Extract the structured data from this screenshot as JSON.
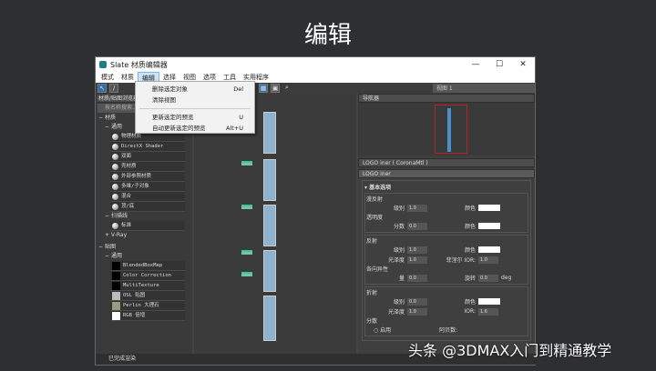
{
  "slide_title": "编辑",
  "window": {
    "title": "Slate 材质编辑器",
    "minimize": "—",
    "maximize": "☐",
    "close": "✕"
  },
  "menu": [
    "模式",
    "材质",
    "编辑",
    "选择",
    "视图",
    "选项",
    "工具",
    "实用程序"
  ],
  "edit_menu": [
    {
      "label": "删除选定对象",
      "shortcut": "Del"
    },
    {
      "label": "清除视图",
      "shortcut": ""
    },
    {
      "label": "更新选定的预览",
      "shortcut": "U"
    },
    {
      "label": "自动更新选定的预览",
      "shortcut": "Alt+U"
    }
  ],
  "view_select": "视图 1",
  "left": {
    "header": "材质/贴图浏览器",
    "search": "按名称搜索...",
    "materials": "材质",
    "general": "通用",
    "mat_items": [
      "物理材质",
      "DirectX Shader",
      "双面",
      "壳材质",
      "外部参照材质",
      "多维/子对象",
      "混合",
      "顶/底"
    ],
    "scanline": "扫描线",
    "scanline_items": [
      "标准"
    ],
    "vray": "+ V-Ray",
    "maps": "贴图",
    "maps_general": "通用",
    "map_items": [
      "BlendedBoxMap",
      "Color Correction",
      "MultiTexture",
      "OSL 贴图",
      "Perlin 大理石",
      "RGB 倍增"
    ]
  },
  "right": {
    "navigator": "导航器",
    "material_header": "LOGO iner ( CoronaMtl )",
    "material_name": "LOGO iner",
    "basic": "基本选项",
    "diffuse": {
      "title": "漫反射",
      "level_label": "级别",
      "level": "1.0",
      "color_label": "颜色"
    },
    "translucency": {
      "title": "透明度",
      "fraction_label": "分数",
      "fraction": "0.0",
      "color_label": "颜色"
    },
    "reflection": {
      "title": "反射",
      "level_label": "级别",
      "level": "1.0",
      "color_label": "颜色",
      "gloss_label": "光泽度",
      "gloss": "1.0",
      "fresnel_label": "菲涅尔 IOR:",
      "fresnel": "1.0"
    },
    "anisotropy": {
      "title": "各向异性",
      "amount_label": "量",
      "amount": "0.0",
      "rotation_label": "旋转",
      "rotation": "0.0",
      "unit": "deg"
    },
    "refraction": {
      "title": "折射",
      "level_label": "级别",
      "level": "0.0",
      "color_label": "颜色",
      "gloss_label": "光泽度",
      "gloss": "1.0",
      "ior_label": "IOR:",
      "ior": "1.6"
    },
    "dispersion": {
      "title": "分散",
      "enable": "启用",
      "abbe_label": "阿贝数:"
    }
  },
  "status": "已完成渲染",
  "watermark": "头条 @3DMAX入门到精通教学"
}
